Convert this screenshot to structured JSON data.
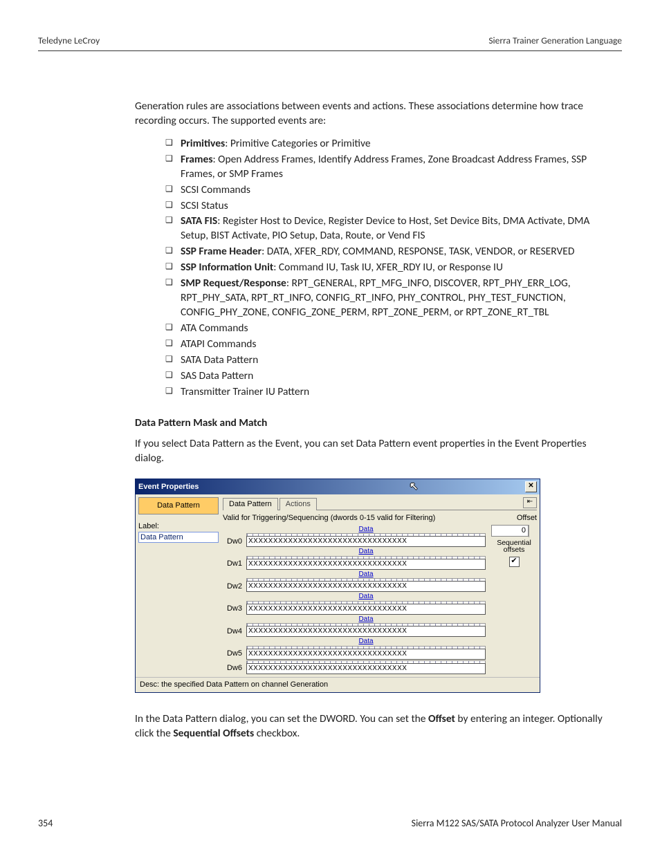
{
  "header": {
    "left": "Teledyne LeCroy",
    "right": "Sierra Trainer Generation Language"
  },
  "intro": "Generation rules are associations between events and actions. These associations determine how trace recording occurs. The supported events are:",
  "events": [
    {
      "bold": "Primitives",
      "rest": ": Primitive Categories or Primitive"
    },
    {
      "bold": "Frames",
      "rest": ": Open Address Frames, Identify Address Frames, Zone Broadcast Address Frames, SSP Frames, or SMP Frames"
    },
    {
      "bold": "",
      "rest": "SCSI Commands"
    },
    {
      "bold": "",
      "rest": "SCSI Status"
    },
    {
      "bold": "SATA FIS",
      "rest": ": Register Host to Device, Register Device to Host, Set Device Bits, DMA Activate, DMA Setup, BIST Activate, PIO Setup, Data, Route, or Vend FIS"
    },
    {
      "bold": "SSP Frame Header",
      "rest": ": DATA, XFER_RDY, COMMAND, RESPONSE, TASK, VENDOR, or RESERVED"
    },
    {
      "bold": "SSP Information Unit",
      "rest": ": Command IU, Task IU, XFER_RDY IU, or Response IU"
    },
    {
      "bold": "SMP Request/Response",
      "rest": ": RPT_GENERAL, RPT_MFG_INFO, DISCOVER, RPT_PHY_ERR_LOG, RPT_PHY_SATA, RPT_RT_INFO, CONFIG_RT_INFO, PHY_CONTROL, PHY_TEST_FUNCTION, CONFIG_PHY_ZONE, CONFIG_ZONE_PERM, RPT_ZONE_PERM, or RPT_ZONE_RT_TBL"
    },
    {
      "bold": "",
      "rest": "ATA Commands"
    },
    {
      "bold": "",
      "rest": "ATAPI Commands"
    },
    {
      "bold": "",
      "rest": "SATA Data Pattern"
    },
    {
      "bold": "",
      "rest": "SAS Data Pattern"
    },
    {
      "bold": "",
      "rest": "Transmitter Trainer IU Pattern"
    }
  ],
  "section_title": "Data Pattern Mask and Match",
  "section_para": "If you select Data Pattern as the Event, you can set Data Pattern event properties in the Event Properties dialog.",
  "dialog": {
    "title": "Event Properties",
    "close_glyph": "✕",
    "pin_glyph": "⇤",
    "category_box": "Data Pattern",
    "label_caption": "Label:",
    "label_value": "Data Pattern",
    "tabs": {
      "active": "Data Pattern",
      "other": "Actions"
    },
    "valid_text": "Valid for Triggering/Sequencing (dwords 0-15 valid for Filtering)",
    "offset_label": "Offset",
    "offset_value": "0",
    "seq_label": "Sequential offsets",
    "seq_checked": "✔",
    "data_link": "Data",
    "dw_value": "XXXXXXXXXXXXXXXXXXXXXXXXXXXXXXXX",
    "rows": [
      "Dw0",
      "Dw1",
      "Dw2",
      "Dw3",
      "Dw4",
      "Dw5",
      "Dw6"
    ],
    "desc": "Desc: the specified Data Pattern on channel Generation"
  },
  "closing": {
    "pre1": "In the Data Pattern dialog, you can set the DWORD. You can set the ",
    "b1": "Offset",
    "mid": " by entering an integer. Optionally click the ",
    "b2": "Sequential Offsets",
    "post": " checkbox."
  },
  "footer": {
    "page": "354",
    "manual": "Sierra M122 SAS/SATA Protocol Analyzer User Manual"
  }
}
